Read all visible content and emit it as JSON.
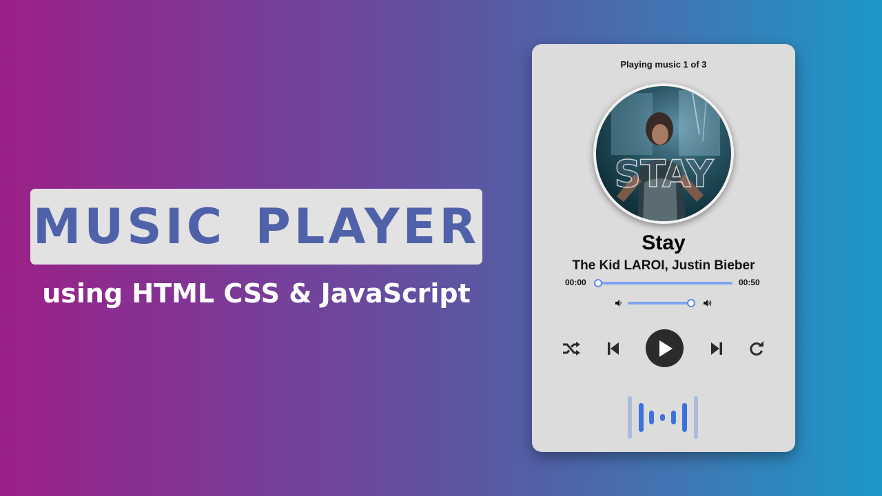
{
  "banner": {
    "title": "MUSIC PLAYER",
    "subtitle": "using HTML CSS & JavaScript"
  },
  "player": {
    "status": "Playing music 1 of 3",
    "cover_text": "STAY",
    "track_title": "Stay",
    "artist": "The Kid LAROI, Justin Bieber",
    "current_time": "00:00",
    "duration": "00:50",
    "seek_progress": 0,
    "volume_level": 0.99,
    "controls": [
      "shuffle-icon",
      "previous-track-icon",
      "play-icon",
      "next-track-icon",
      "repeat-icon"
    ],
    "volume_icons": [
      "volume-down-icon",
      "volume-up-icon"
    ],
    "wave_icon": "audio-wave-icon"
  },
  "colors": {
    "accent": "#7fa3f0",
    "title_text": "#4f62a9",
    "wave": "#3d72dd",
    "card": "#dcdcdc",
    "play_button": "#2b2b2b"
  }
}
